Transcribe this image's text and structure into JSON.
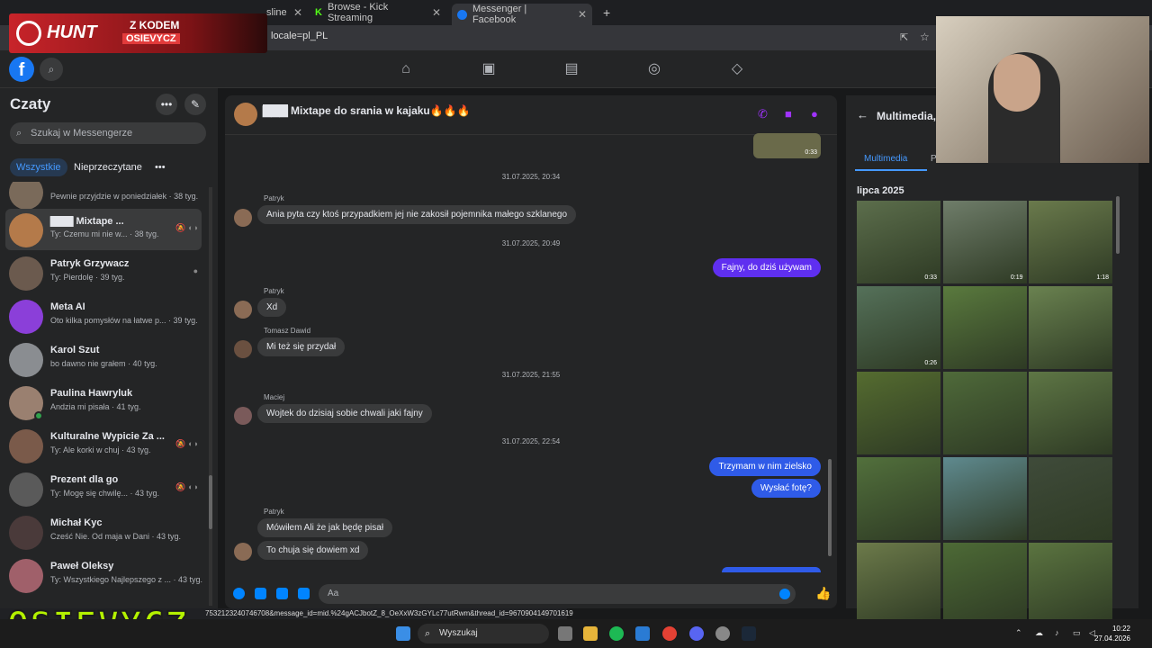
{
  "browser": {
    "tabs": [
      {
        "label": "sline"
      },
      {
        "label": "Browse - Kick Streaming"
      },
      {
        "label": "Messenger | Facebook"
      }
    ],
    "url": "locale=pl_PL",
    "status_url": "7532123240746708&message_id=mid.%24gACJbotZ_8_OeXxW3zGYLc77utRwm&thread_id=9670904149701619"
  },
  "overlay": {
    "hunt_brand": "HUNT",
    "hunt_line1": "Z KODEM",
    "hunt_line2": "OSIEVYCZ",
    "watermark": "OSIEVYCZ"
  },
  "sidebar": {
    "title": "Czaty",
    "search_placeholder": "Szukaj w Messengerze",
    "filters": [
      "Wszystkie",
      "Nieprzeczytane"
    ],
    "chats": [
      {
        "name": "",
        "preview": "Pewnie przyjdzie w poniedziałek · 38 tyg."
      },
      {
        "name": "Mixtape ...",
        "preview": "Ty: Czemu mi nie w... · 38 tyg."
      },
      {
        "name": "Patryk Grzywacz",
        "preview": "Ty: Pierdolę · 39 tyg."
      },
      {
        "name": "Meta AI",
        "preview": "Oto kilka pomysłów na łatwe p... · 39 tyg."
      },
      {
        "name": "Karol Szut",
        "preview": "bo dawno nie grałem · 40 tyg."
      },
      {
        "name": "Paulina Hawryluk",
        "preview": "Andzia mi pisała · 41 tyg."
      },
      {
        "name": "Kulturalne Wypicie Za ...",
        "preview": "Ty: Ale korki w chuj · 43 tyg."
      },
      {
        "name": "Prezent dla go",
        "preview": "Ty: Mogę się chwilę... · 43 tyg."
      },
      {
        "name": "Michał Kyc",
        "preview": "Cześć Nie. Od maja w Dani · 43 tyg."
      },
      {
        "name": "Paweł Oleksy",
        "preview": "Ty: Wszystkiego Najlepszego z ... · 43 tyg."
      }
    ]
  },
  "conversation": {
    "title": "Mixtape do srania w kajaku🔥🔥🔥",
    "video_duration": "0:33",
    "messages": [
      {
        "kind": "ts",
        "text": "31.07.2025, 20:34"
      },
      {
        "kind": "sender",
        "text": "Patryk"
      },
      {
        "kind": "in",
        "text": "Ania pyta czy ktoś przypadkiem jej nie zakosił pojemnika małego szklanego"
      },
      {
        "kind": "ts",
        "text": "31.07.2025, 20:49"
      },
      {
        "kind": "out",
        "text": "Fajny, do dziś używam"
      },
      {
        "kind": "sender",
        "text": "Patryk"
      },
      {
        "kind": "in",
        "text": "Xd"
      },
      {
        "kind": "sender",
        "text": "Tomasz Dawid"
      },
      {
        "kind": "in",
        "text": "Mi też się przydał"
      },
      {
        "kind": "ts",
        "text": "31.07.2025, 21:55"
      },
      {
        "kind": "sender",
        "text": "Maciej"
      },
      {
        "kind": "in",
        "text": "Wojtek do dzisiaj sobie chwali jaki fajny"
      },
      {
        "kind": "ts",
        "text": "31.07.2025, 22:54"
      },
      {
        "kind": "out",
        "text": "Trzymam w nim zielsko"
      },
      {
        "kind": "out",
        "text": "Wysłać fotę?"
      },
      {
        "kind": "sender",
        "text": "Patryk"
      },
      {
        "kind": "in",
        "text": "Mówiłem Ali że jak będę pisał"
      },
      {
        "kind": "in",
        "text": "To chuja się dowiem xd"
      }
    ],
    "composer_placeholder": "Aa"
  },
  "media": {
    "title": "Multimedia,",
    "tabs": [
      "Multimedia",
      "Pli"
    ],
    "month": "lipca 2025",
    "thumbs": [
      {
        "dur": "0:33",
        "color": "#5c6e4c"
      },
      {
        "dur": "0:19",
        "color": "#6f7d6a"
      },
      {
        "dur": "1:18",
        "color": "#6a7a4c"
      },
      {
        "dur": "0:26",
        "color": "#55715a"
      },
      {
        "dur": "",
        "color": "#5a7a3e"
      },
      {
        "dur": "",
        "color": "#6a8250"
      },
      {
        "dur": "",
        "color": "#556c30"
      },
      {
        "dur": "",
        "color": "#4f6a3a"
      },
      {
        "dur": "",
        "color": "#5e7645"
      },
      {
        "dur": "",
        "color": "#52703c"
      },
      {
        "dur": "",
        "color": "#5f8a8f"
      },
      {
        "dur": "",
        "color": "#3f4b3a"
      },
      {
        "dur": "",
        "color": "#6c7a4a"
      },
      {
        "dur": "",
        "color": "#4d6a36"
      },
      {
        "dur": "",
        "color": "#5b7440"
      }
    ]
  },
  "taskbar": {
    "search_label": "Wyszukaj",
    "time": "10:22",
    "date": "27.04.2026"
  }
}
